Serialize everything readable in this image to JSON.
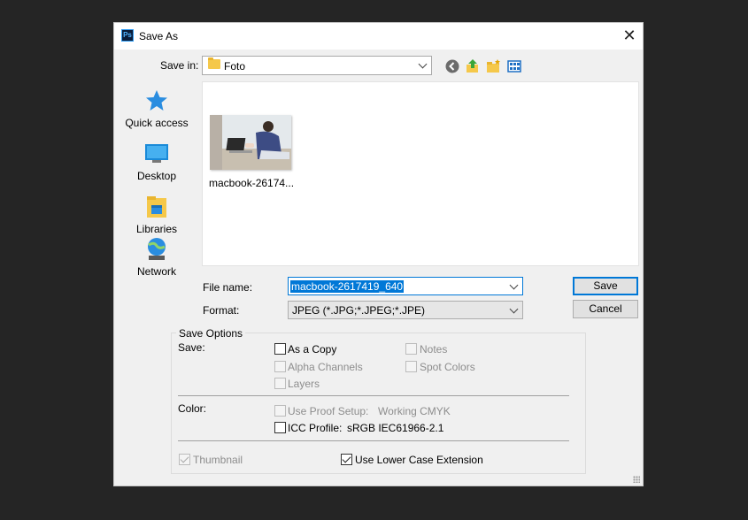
{
  "window": {
    "title": "Save As",
    "app_icon": "Ps"
  },
  "save_in": {
    "label": "Save in:",
    "value": "Foto"
  },
  "places": [
    {
      "label": "Quick access",
      "icon": "star-icon"
    },
    {
      "label": "Desktop",
      "icon": "desktop-icon"
    },
    {
      "label": "Libraries",
      "icon": "libraries-icon"
    },
    {
      "label": "Network",
      "icon": "network-icon"
    }
  ],
  "files": [
    {
      "name": "macbook-26174..."
    }
  ],
  "file_name": {
    "label": "File name:",
    "value": "macbook-2617419_640"
  },
  "format": {
    "label": "Format:",
    "value": "JPEG (*.JPG;*.JPEG;*.JPE)"
  },
  "buttons": {
    "save": "Save",
    "cancel": "Cancel"
  },
  "save_options": {
    "legend": "Save Options",
    "save_label": "Save:",
    "as_a_copy": "As a Copy",
    "notes": "Notes",
    "alpha_channels": "Alpha Channels",
    "spot_colors": "Spot Colors",
    "layers": "Layers",
    "color_label": "Color:",
    "use_proof_setup": "Use Proof Setup:",
    "proof_value": "Working CMYK",
    "icc_profile": "ICC Profile:",
    "icc_value": "sRGB IEC61966-2.1",
    "thumbnail": "Thumbnail",
    "lower_case": "Use Lower Case Extension"
  },
  "colors": {
    "accent": "#0078d7",
    "background": "#252525",
    "dialog": "#f0f0f0"
  }
}
